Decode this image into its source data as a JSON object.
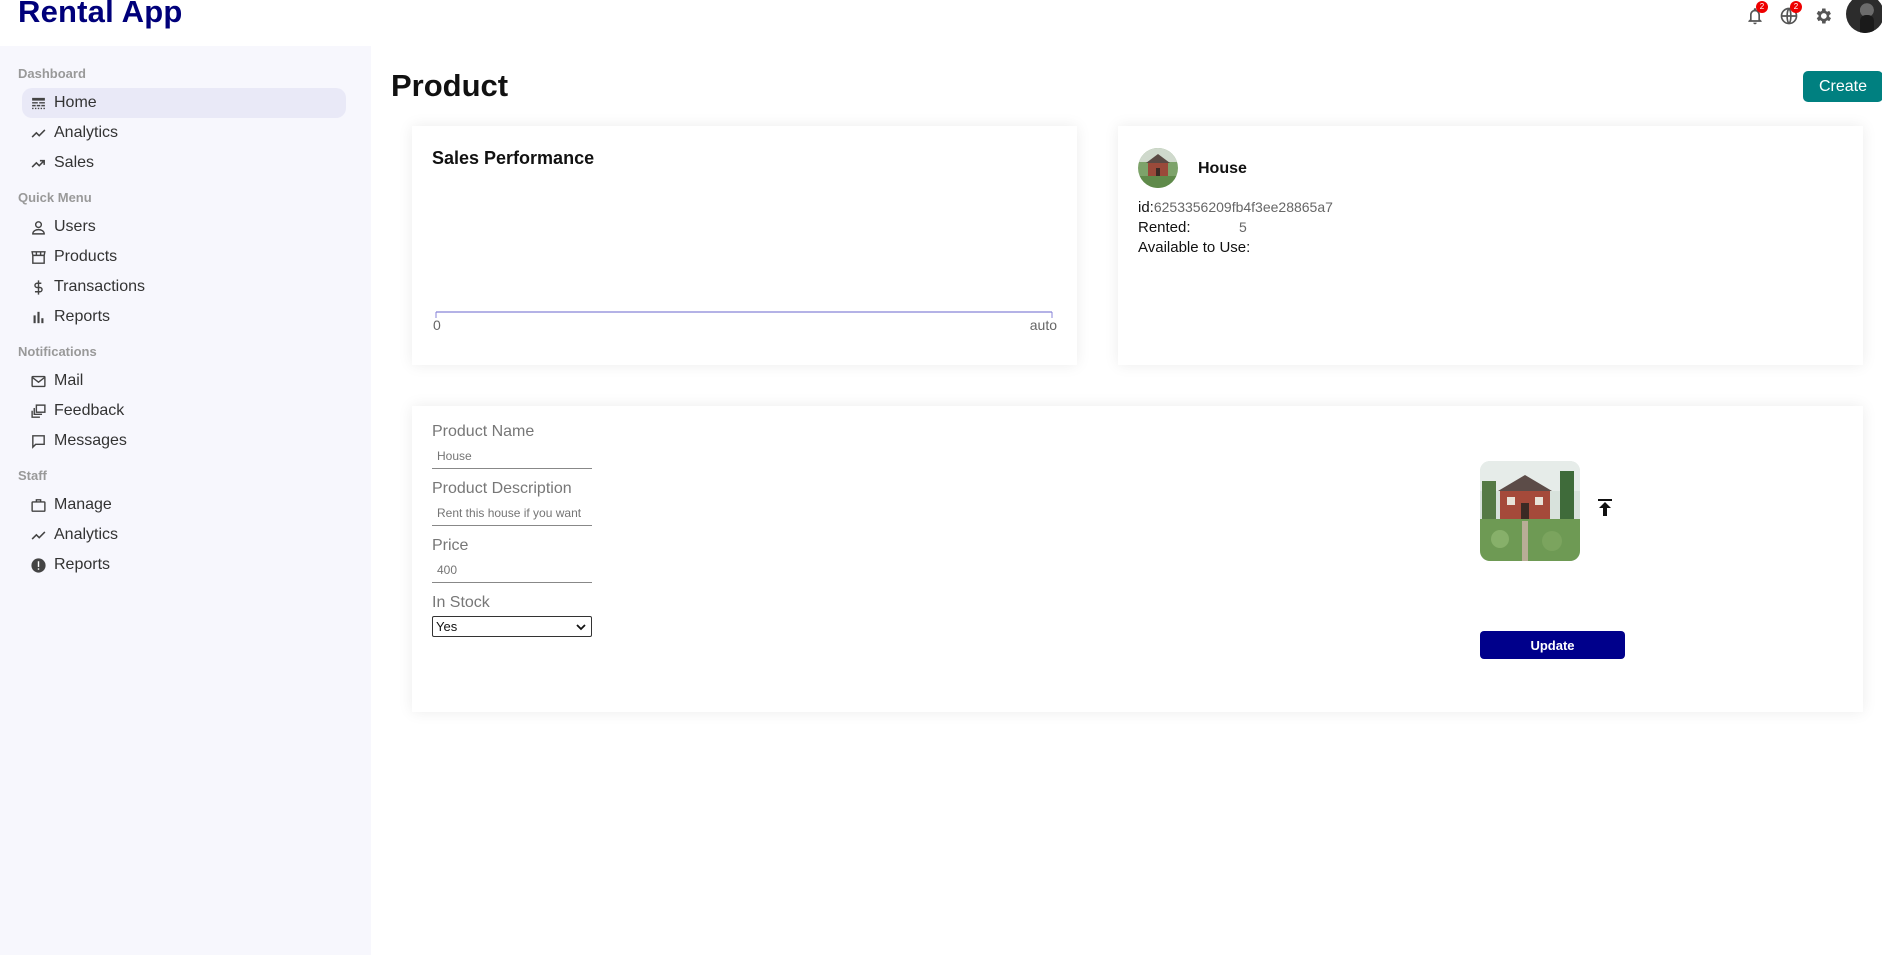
{
  "app": {
    "title": "Rental App"
  },
  "header": {
    "notifications_badge": "2",
    "language_badge": "2",
    "icons": [
      "bell-icon",
      "globe-icon",
      "gear-icon",
      "avatar"
    ]
  },
  "sidebar": {
    "sections": [
      {
        "title": "Dashboard",
        "items": [
          {
            "label": "Home",
            "icon": "line-style-icon",
            "active": true
          },
          {
            "label": "Analytics",
            "icon": "timeline-icon"
          },
          {
            "label": "Sales",
            "icon": "trending-up-icon"
          }
        ]
      },
      {
        "title": "Quick Menu",
        "items": [
          {
            "label": "Users",
            "icon": "person-icon"
          },
          {
            "label": "Products",
            "icon": "storefront-icon"
          },
          {
            "label": "Transactions",
            "icon": "dollar-icon"
          },
          {
            "label": "Reports",
            "icon": "bar-chart-icon"
          }
        ]
      },
      {
        "title": "Notifications",
        "items": [
          {
            "label": "Mail",
            "icon": "mail-icon"
          },
          {
            "label": "Feedback",
            "icon": "dynamic-feed-icon"
          },
          {
            "label": "Messages",
            "icon": "chat-bubble-icon"
          }
        ]
      },
      {
        "title": "Staff",
        "items": [
          {
            "label": "Manage",
            "icon": "work-icon"
          },
          {
            "label": "Analytics",
            "icon": "timeline-icon"
          },
          {
            "label": "Reports",
            "icon": "report-icon"
          }
        ]
      }
    ]
  },
  "main": {
    "page_title": "Product",
    "create_label": "Create",
    "chart": {
      "title": "Sales Performance",
      "tick_min": "0",
      "tick_max": "auto"
    },
    "info": {
      "name": "House",
      "id_label": "id:",
      "id_value": "6253356209fb4f3ee28865a7",
      "rented_label": "Rented:",
      "rented_value": "5",
      "available_label": "Available to Use:"
    },
    "form": {
      "name_label": "Product Name",
      "name_placeholder": "House",
      "desc_label": "Product Description",
      "desc_placeholder": "Rent this house if you want",
      "price_label": "Price",
      "price_placeholder": "400",
      "stock_label": "In Stock",
      "stock_value": "Yes",
      "update_label": "Update"
    }
  },
  "colors": {
    "brand": "#00007a",
    "create_button": "#008080",
    "update_button": "#00008b",
    "chart_axis": "#8884d8",
    "sidebar_bg": "#f7f7fd"
  }
}
